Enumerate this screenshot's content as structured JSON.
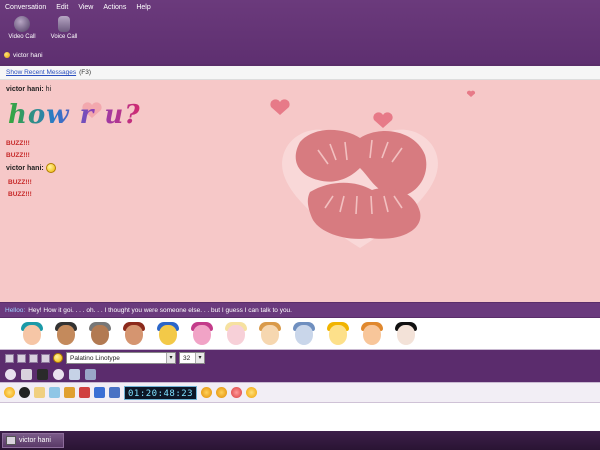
{
  "menu": [
    "Conversation",
    "Edit",
    "View",
    "Actions",
    "Help"
  ],
  "toolbar": {
    "video_call": "Video Call",
    "voice_call": "Voice Call"
  },
  "contact": {
    "name": "victor hani"
  },
  "recent": {
    "link": "Show Recent Messages",
    "shortcut": "(F3)"
  },
  "chat": {
    "msg1_sender": "victor hani:",
    "msg1_text": " hi",
    "styled_text": "how r u?",
    "buzz1": "BUZZ!!!",
    "buzz2": "BUZZ!!!",
    "msg2_sender": "victor hani:",
    "buzz3": "BUZZ!!!",
    "buzz4": "BUZZ!!!"
  },
  "nudge": {
    "link": "Helloo:",
    "text": "Hey! How it goi. . . . oh. . . I thought you were someone else. . . but I guess I can talk to you."
  },
  "format": {
    "font": "Palatino Linotype",
    "size": "32",
    "arrow": "▾"
  },
  "timer": {
    "value": "01:20:48:23"
  },
  "taskbar": {
    "window_label": "victor hani"
  },
  "colors": {
    "chrome": "#5e2f70",
    "chat_bg": "#f6c8c8",
    "link": "#2a4fbf",
    "buzz": "#c62828"
  }
}
